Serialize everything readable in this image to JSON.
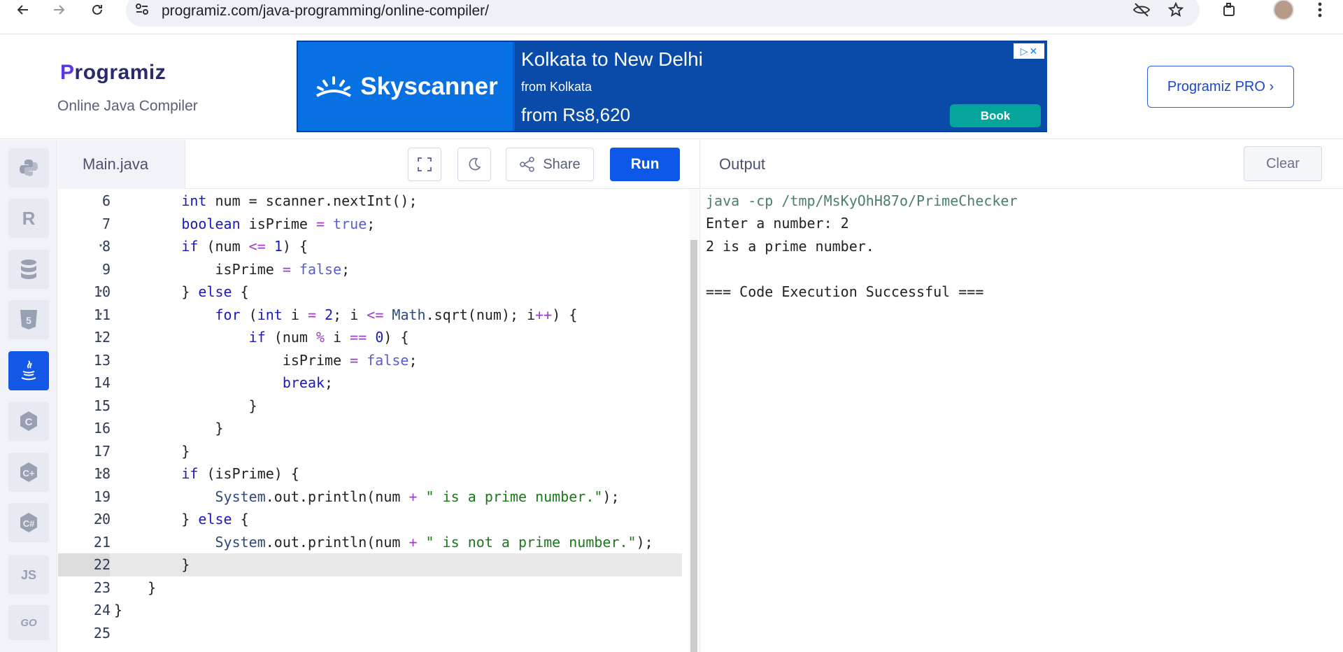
{
  "browser": {
    "url": "programiz.com/java-programming/online-compiler/"
  },
  "header": {
    "logo_prefix": "P",
    "logo_rest": "rogramiz",
    "subtitle": "Online Java Compiler",
    "pro_button": "Programiz PRO ›"
  },
  "ad": {
    "brand": "Skyscanner",
    "title": "Kolkata to New Delhi",
    "from_city": "from Kolkata",
    "price": "from Rs8,620",
    "cta": "Book"
  },
  "sidebar": {
    "items": [
      {
        "name": "python",
        "label": ""
      },
      {
        "name": "r",
        "label": "R"
      },
      {
        "name": "sql",
        "label": ""
      },
      {
        "name": "html",
        "label": "5"
      },
      {
        "name": "java",
        "label": "",
        "active": true
      },
      {
        "name": "c",
        "label": "C"
      },
      {
        "name": "cpp",
        "label": "C+"
      },
      {
        "name": "csharp",
        "label": "C#"
      },
      {
        "name": "js",
        "label": "JS"
      },
      {
        "name": "go",
        "label": "GO"
      }
    ]
  },
  "editor": {
    "file_tab": "Main.java",
    "share_label": "Share",
    "run_label": "Run",
    "active_line": 22,
    "lines": [
      {
        "n": "6",
        "fold": false
      },
      {
        "n": "7",
        "fold": false
      },
      {
        "n": "8",
        "fold": true
      },
      {
        "n": "9",
        "fold": false
      },
      {
        "n": "10",
        "fold": true
      },
      {
        "n": "11",
        "fold": true
      },
      {
        "n": "12",
        "fold": true
      },
      {
        "n": "13",
        "fold": false
      },
      {
        "n": "14",
        "fold": false
      },
      {
        "n": "15",
        "fold": false
      },
      {
        "n": "16",
        "fold": false
      },
      {
        "n": "17",
        "fold": false
      },
      {
        "n": "18",
        "fold": true
      },
      {
        "n": "19",
        "fold": false
      },
      {
        "n": "20",
        "fold": true
      },
      {
        "n": "21",
        "fold": false
      },
      {
        "n": "22",
        "fold": false
      },
      {
        "n": "23",
        "fold": false
      },
      {
        "n": "24",
        "fold": false
      },
      {
        "n": "25",
        "fold": false
      }
    ]
  },
  "output": {
    "title": "Output",
    "clear_label": "Clear",
    "command": "java -cp /tmp/MsKyOhH87o/PrimeChecker",
    "line1": "Enter a number: 2",
    "line2": "2 is a prime number.",
    "line3": "",
    "line4": "=== Code Execution Successful ==="
  }
}
